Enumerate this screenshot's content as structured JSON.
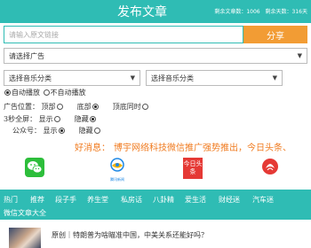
{
  "header": {
    "title": "发布文章",
    "remaining_articles": "剩余文章数：1006",
    "remaining_days": "剩余天数：316天"
  },
  "url_input": {
    "placeholder": "请输入原文链接",
    "value": ""
  },
  "share_button": "分享",
  "ad_select": {
    "selected": "请选择广告"
  },
  "music_selects": [
    {
      "selected": "选择音乐分类"
    },
    {
      "selected": "选择音乐分类"
    }
  ],
  "autoplay": {
    "options": [
      "自动播放",
      "不自动播放"
    ],
    "selected": "自动播放"
  },
  "ad_position": {
    "label": "广告位置：",
    "options": [
      "顶部",
      "底部",
      "顶底同时"
    ],
    "selected": "底部"
  },
  "fullscreen": {
    "label": "3秒全屏：",
    "options": [
      "显示",
      "隐藏"
    ],
    "selected": "隐藏"
  },
  "official_account": {
    "label": "公众号：",
    "options": [
      "显示",
      "隐藏"
    ],
    "selected": "显示"
  },
  "news": {
    "prefix": "好消息：",
    "message": "博宇网络科技微信推广强势推出，今日头条、"
  },
  "platforms": [
    {
      "name": "wechat",
      "label": ""
    },
    {
      "name": "tencent-news",
      "label": "腾讯新闻"
    },
    {
      "name": "toutiao",
      "label": "今日头条"
    },
    {
      "name": "phoenix",
      "label": ""
    }
  ],
  "tabs": [
    "热门",
    "推荐",
    "段子手",
    "养生堂",
    "私房话",
    "八卦精",
    "爱生活",
    "财经迷",
    "汽车迷",
    "微信文章大全"
  ],
  "article": {
    "title": "原创｜特朗普为啥瞄准中国，中美关系还能好吗？"
  },
  "colors": {
    "teal": "#2fbcb4",
    "orange": "#f29c34",
    "news_orange": "#f07a1e"
  }
}
